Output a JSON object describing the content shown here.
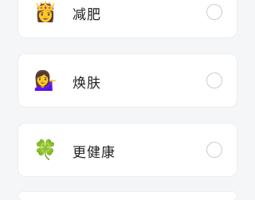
{
  "options": [
    {
      "label": "减肥",
      "emoji": "👸",
      "icon": "princess-icon",
      "selected": false
    },
    {
      "label": "焕肤",
      "emoji": "💁‍♀️",
      "icon": "woman-tipping-hand-icon",
      "selected": false
    },
    {
      "label": "更健康",
      "emoji": "🍀",
      "icon": "four-leaf-clover-icon",
      "selected": false
    }
  ]
}
